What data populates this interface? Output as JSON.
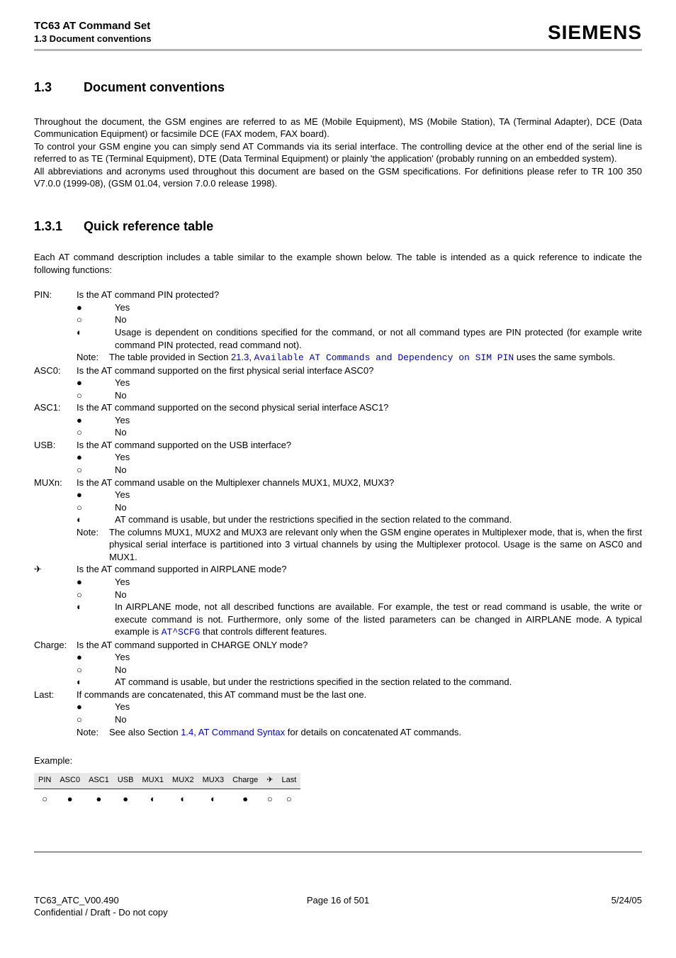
{
  "header": {
    "title": "TC63 AT Command Set",
    "subtitle": "1.3 Document conventions",
    "logo": "SIEMENS"
  },
  "section13": {
    "num": "1.3",
    "title": "Document conventions",
    "para": "Throughout the document, the GSM engines are referred to as ME (Mobile Equipment), MS (Mobile Station), TA (Terminal Adapter), DCE (Data Communication Equipment) or facsimile DCE (FAX modem, FAX board).\nTo control your GSM engine you can simply send AT Commands via its serial interface. The controlling device at the other end of the serial line is referred to as TE (Terminal Equipment), DTE (Data Terminal Equipment) or plainly 'the application' (probably running on an embedded system).\nAll abbreviations and acronyms used throughout this document are based on the GSM specifications. For definitions please refer to TR 100 350 V7.0.0 (1999-08), (GSM 01.04, version 7.0.0 release 1998)."
  },
  "section131": {
    "num": "1.3.1",
    "title": "Quick reference table",
    "intro": "Each AT command description includes a table similar to the example shown below. The table is intended as a quick reference to indicate the following functions:"
  },
  "defs": {
    "pin": {
      "label": "PIN:",
      "q": "Is the AT command PIN protected?",
      "yes": "Yes",
      "no": "No",
      "partial": "Usage is dependent on conditions specified for the command, or not all command types are PIN protected (for example write command PIN protected, read command not).",
      "note_label": "Note:",
      "note_a": "The table provided in Section ",
      "note_link_num": "21.3",
      "note_sep": ", ",
      "note_link_text": "Available AT Commands and Dependency on SIM PIN",
      "note_b": " uses the same symbols."
    },
    "asc0": {
      "label": "ASC0:",
      "q": "Is the AT command supported on the first physical serial interface ASC0?",
      "yes": "Yes",
      "no": "No"
    },
    "asc1": {
      "label": "ASC1:",
      "q": "Is the AT command supported on the second physical serial interface ASC1?",
      "yes": "Yes",
      "no": "No"
    },
    "usb": {
      "label": "USB:",
      "q": "Is the AT command supported on the USB interface?",
      "yes": "Yes",
      "no": "No"
    },
    "mux": {
      "label": "MUXn:",
      "q": "Is the AT command usable on the Multiplexer channels MUX1, MUX2, MUX3?",
      "yes": "Yes",
      "no": "No",
      "partial": "AT command is usable, but under the restrictions specified in the section related to the command.",
      "note_label": "Note:",
      "note": "The columns MUX1, MUX2 and MUX3 are relevant only when the GSM engine operates in Multiplexer mode, that is, when the first physical serial interface is partitioned into 3 virtual channels by using the Multiplexer protocol. Usage is the same on ASC0 and MUX1."
    },
    "airplane": {
      "q": "Is the AT command supported in AIRPLANE mode?",
      "yes": "Yes",
      "no": "No",
      "partial_a": "In AIRPLANE mode, not all described functions are available. For example, the test or read command is usable, the write or execute command is not. Furthermore, only some of the listed parameters can be changed in AIRPLANE mode. A typical example is ",
      "partial_link": "AT^SCFG",
      "partial_b": " that controls different features."
    },
    "charge": {
      "label": "Charge:",
      "q": "Is the AT command supported in CHARGE ONLY mode?",
      "yes": "Yes",
      "no": "No",
      "partial": "AT command is usable, but under the restrictions specified in the section related to the command."
    },
    "last": {
      "label": "Last:",
      "q": "If commands are concatenated, this AT command must be the last one.",
      "yes": "Yes",
      "no": "No",
      "note_label": "Note:",
      "note_a": "See also Section ",
      "note_link_num": "1.4",
      "note_sep": ", ",
      "note_link_text": "AT Command Syntax",
      "note_b": " for details on concatenated AT commands."
    }
  },
  "symbols": {
    "filled": "●",
    "empty": "○",
    "half": "◐",
    "plane": "✈"
  },
  "example": {
    "label": "Example:",
    "headers": [
      "PIN",
      "ASC0",
      "ASC1",
      "USB",
      "MUX1",
      "MUX2",
      "MUX3",
      "Charge",
      "✈",
      "Last"
    ],
    "row": [
      "○",
      "●",
      "●",
      "●",
      "◐",
      "◐",
      "◐",
      "●",
      "○",
      "○"
    ]
  },
  "footer": {
    "left1": "TC63_ATC_V00.490",
    "left2": "Confidential / Draft - Do not copy",
    "center": "Page 16 of 501",
    "right": "5/24/05"
  }
}
